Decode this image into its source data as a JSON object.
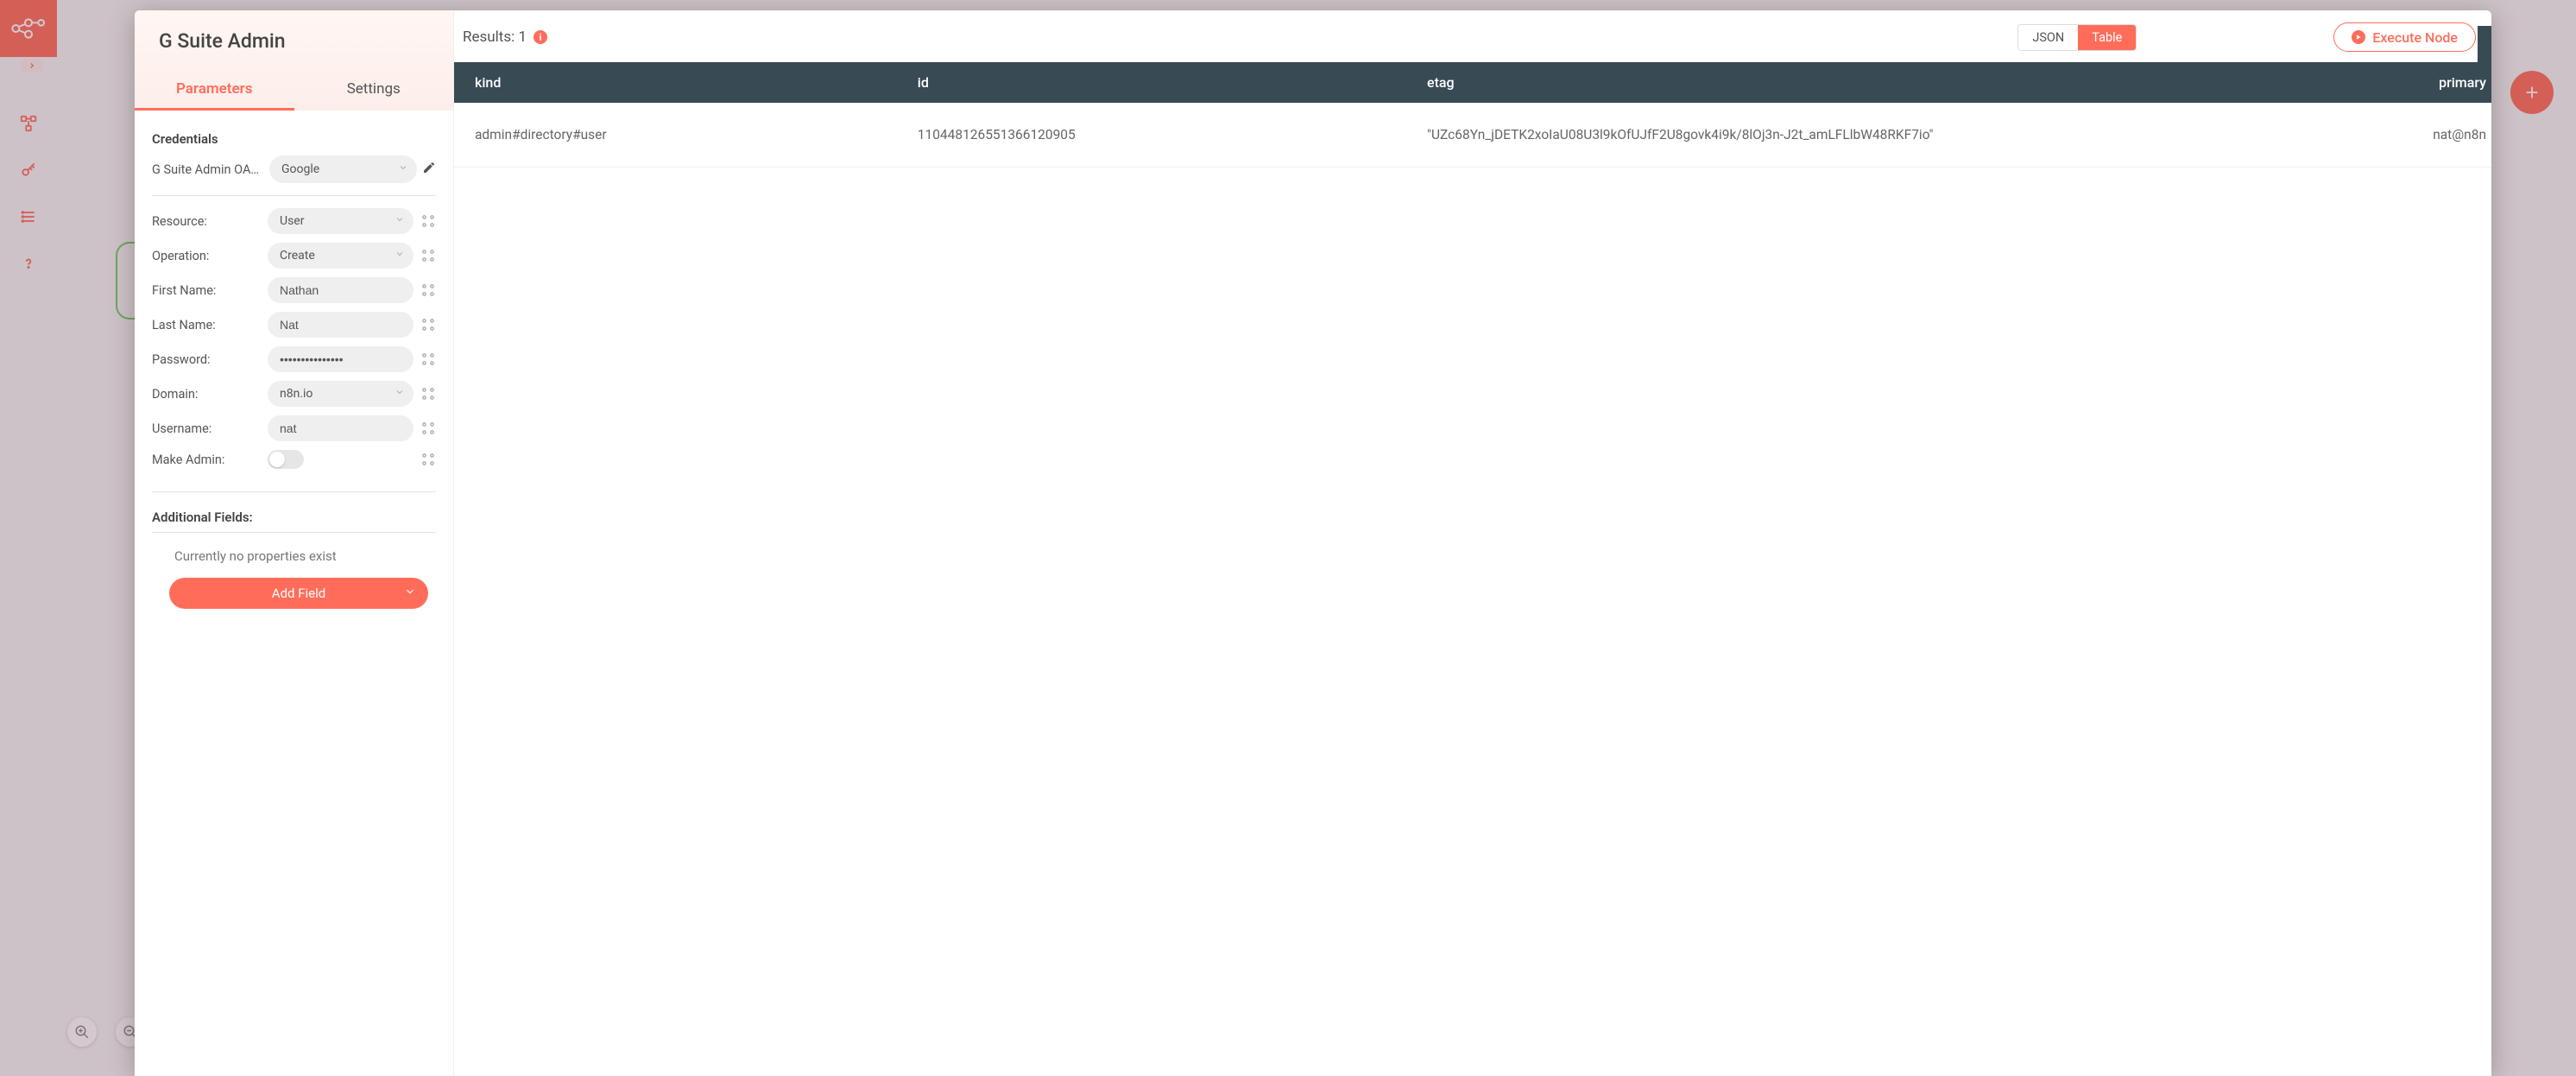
{
  "sidebar": {
    "items": [
      "workflows",
      "credentials",
      "executions",
      "help"
    ]
  },
  "node": {
    "title": "G Suite Admin",
    "tabs": {
      "parameters": "Parameters",
      "settings": "Settings"
    },
    "credentials": {
      "heading": "Credentials",
      "label": "G Suite Admin OAut...",
      "value": "Google"
    },
    "params": {
      "resource": {
        "label": "Resource:",
        "value": "User"
      },
      "operation": {
        "label": "Operation:",
        "value": "Create"
      },
      "first_name": {
        "label": "First Name:",
        "value": "Nathan"
      },
      "last_name": {
        "label": "Last Name:",
        "value": "Nat"
      },
      "password": {
        "label": "Password:",
        "value": "•••••••••••••••"
      },
      "domain": {
        "label": "Domain:",
        "value": "n8n.io"
      },
      "username": {
        "label": "Username:",
        "value": "nat"
      },
      "make_admin": {
        "label": "Make Admin:",
        "value": false
      }
    },
    "additional": {
      "heading": "Additional Fields:",
      "empty_text": "Currently no properties exist",
      "add_button": "Add Field"
    }
  },
  "results": {
    "label": "Results: 1",
    "view_json": "JSON",
    "view_table": "Table",
    "execute_label": "Execute Node",
    "columns": {
      "kind": "kind",
      "id": "id",
      "etag": "etag",
      "primary": "primary"
    },
    "rows": [
      {
        "kind": "admin#directory#user",
        "id": "110448126551366120905",
        "etag": "\"UZc68Yn_jDETK2xoIaU08U3l9kOfUJfF2U8govk4i9k/8lOj3n-J2t_amLFLlbW48RKF7io\"",
        "primary": "nat@n8n"
      }
    ]
  }
}
